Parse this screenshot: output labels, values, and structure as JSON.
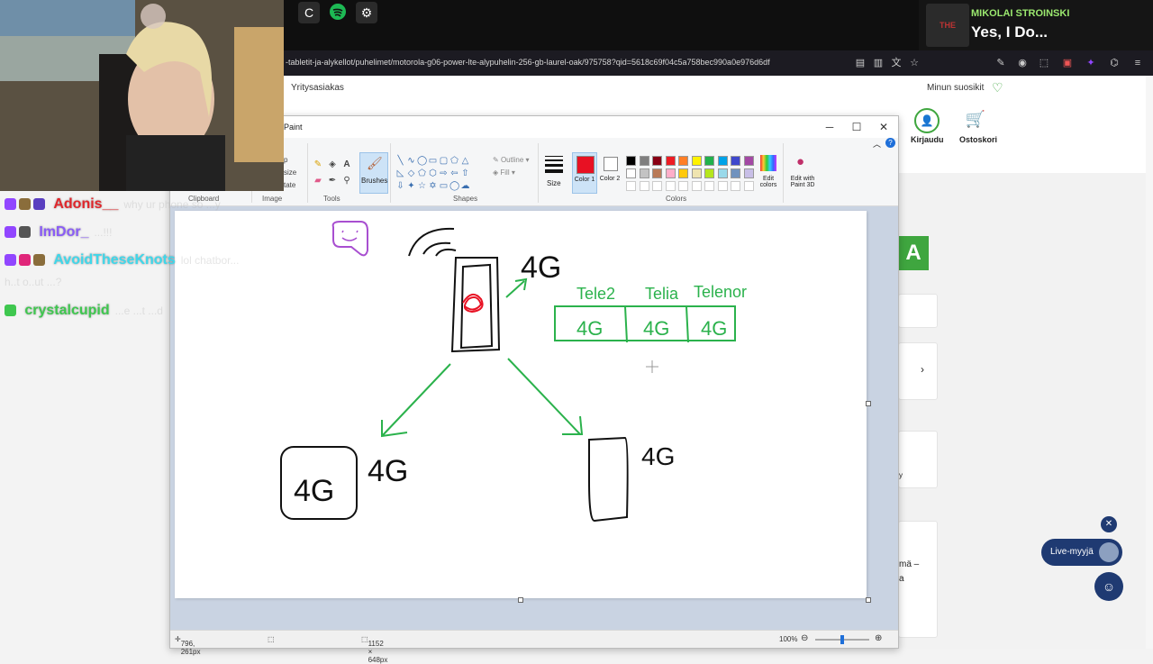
{
  "topbar": {
    "icons": [
      "c-browser-icon",
      "spotify-icon",
      "app-icon"
    ]
  },
  "music": {
    "artist": "MIKOLAI STROINSKI",
    "song": "Yes, I Do...",
    "art_label": "THE WITCHER"
  },
  "browser": {
    "url": "-tabletit-ja-alykellot/puhelimet/motorola-g06-power-lte-alypuhelin-256-gb-laurel-oak/975758?qid=5618c69f04c5a758bec990a0e976d6df"
  },
  "web": {
    "top_link": "Yritysasiakas",
    "favorites": "Minun suosikit",
    "login": "Kirjaudu",
    "cart": "Ostoskori",
    "live_seller": "Live-myyjä",
    "energy_label": "A",
    "partial_text_1": "y",
    "partial_text_2": "mä –",
    "partial_text_3": "a"
  },
  "paint": {
    "title": "Paint",
    "groups": {
      "clipboard": "Clipboard",
      "image": "Image",
      "tools": "Tools",
      "shapes": "Shapes",
      "colors": "Colors"
    },
    "image_items": [
      "Crop",
      "Resize",
      "Rotate"
    ],
    "image_items_visible": [
      "p",
      "size",
      "tate"
    ],
    "brushes": "Brushes",
    "outline": "Outline",
    "fill": "Fill",
    "size": "Size",
    "color1": "Color 1",
    "color2": "Color 2",
    "edit_colors": "Edit colors",
    "edit_3d": "Edit with Paint 3D",
    "color1_hex": "#e81123",
    "palette": [
      "#000000",
      "#7f7f7f",
      "#880015",
      "#ed1c24",
      "#ff7f27",
      "#fff200",
      "#22b14c",
      "#00a2e8",
      "#3f48cc",
      "#a349a4",
      "#ffffff",
      "#c3c3c3",
      "#b97a57",
      "#ffaec9",
      "#ffc90e",
      "#efe4b0",
      "#b5e61d",
      "#99d9ea",
      "#7092be",
      "#c8bfe7"
    ],
    "status": {
      "position": "796, 261px",
      "canvas_size": "1152 × 648px",
      "zoom": "100%"
    },
    "drawing_text": {
      "label_4g_tower": "4G",
      "carrier1": "Tele2",
      "carrier2": "Telia",
      "carrier3": "Telenor",
      "cell1": "4G",
      "cell2": "4G",
      "cell3": "4G",
      "label_4g_left": "4G",
      "box_4g_left": "4G",
      "label_4g_right": "4G"
    }
  },
  "chat": [
    {
      "user": "Adonis__",
      "color": "#e0262b",
      "text": "why ur phone so ...y"
    },
    {
      "user": "ImDor_",
      "color": "#8a5cf6",
      "text": "...!!!"
    },
    {
      "user": "AvoidTheseKnots",
      "color": "#3fd7ea",
      "text": "lol chatbor..."
    },
    {
      "user": "",
      "color": "#cccccc",
      "text": "h..t o..ut ...?"
    },
    {
      "user": "crystalcupid",
      "color": "#3fc74f",
      "text": "...e ...t ...d"
    }
  ]
}
